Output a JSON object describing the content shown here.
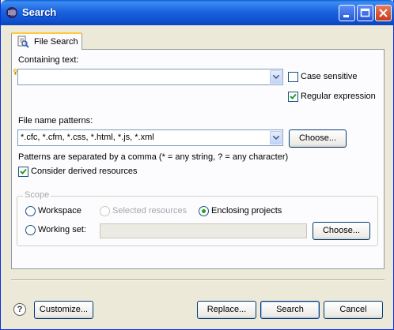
{
  "window": {
    "title": "Search"
  },
  "tabs": [
    {
      "label": "File Search"
    }
  ],
  "containing_text": {
    "label": "Containing text:",
    "value": "",
    "case_sensitive": {
      "label": "Case sensitive",
      "checked": false
    },
    "regular_expression": {
      "label": "Regular expression",
      "checked": true
    }
  },
  "file_name_patterns": {
    "label": "File name patterns:",
    "value": "*.cfc, *.cfm, *.css, *.html, *.js, *.xml",
    "choose_label": "Choose...",
    "hint": "Patterns are separated by a comma (* = any string, ? = any character)",
    "consider_derived": {
      "label": "Consider derived resources",
      "checked": true
    }
  },
  "scope": {
    "title": "Scope",
    "workspace": {
      "label": "Workspace",
      "selected": false
    },
    "selected_resources": {
      "label": "Selected resources",
      "enabled": false
    },
    "enclosing_projects": {
      "label": "Enclosing projects",
      "selected": true
    },
    "working_set": {
      "label": "Working set:",
      "value": "",
      "choose_label": "Choose..."
    }
  },
  "footer": {
    "help_glyph": "?",
    "customize_label": "Customize...",
    "replace_label": "Replace...",
    "search_label": "Search",
    "cancel_label": "Cancel"
  },
  "colors": {
    "title_bar": "#0a5fd8",
    "dialog_bg": "#ece9d8",
    "tab_accent": "#ffc83c",
    "radio_dot": "#21a121"
  },
  "icons": [
    "eclipse-logo-icon",
    "minimize-icon",
    "maximize-icon",
    "close-icon",
    "file-search-icon",
    "lightbulb-icon",
    "help-icon",
    "checkmark-icon",
    "chevron-down-icon"
  ]
}
